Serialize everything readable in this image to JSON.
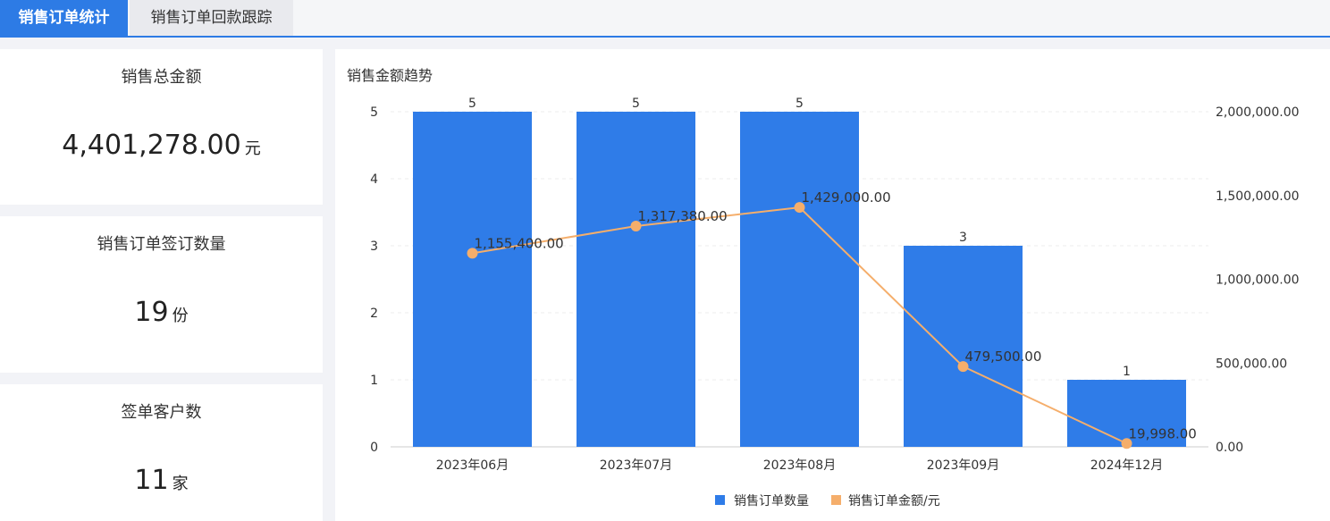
{
  "tabs": [
    {
      "label": "销售订单统计",
      "active": true
    },
    {
      "label": "销售订单回款跟踪",
      "active": false
    }
  ],
  "stats": {
    "total_amount": {
      "label": "销售总金额",
      "value": "4,401,278.00",
      "unit": "元"
    },
    "order_count": {
      "label": "销售订单签订数量",
      "value": "19",
      "unit": "份"
    },
    "customer_count": {
      "label": "签单客户数",
      "value": "11",
      "unit": "家"
    }
  },
  "colors": {
    "accent": "#2d7be5",
    "bar": "#2f7ce8",
    "line": "#f5ae6b"
  },
  "chart_data": {
    "type": "bar",
    "title": "销售金额趋势",
    "categories": [
      "2023年06月",
      "2023年07月",
      "2023年08月",
      "2023年09月",
      "2024年12月"
    ],
    "series": [
      {
        "name": "销售订单数量",
        "type": "bar",
        "axis": "left",
        "values": [
          5,
          5,
          5,
          3,
          1
        ],
        "labels": [
          "5",
          "5",
          "5",
          "3",
          "1"
        ]
      },
      {
        "name": "销售订单金额/元",
        "type": "line",
        "axis": "right",
        "values": [
          1155400,
          1317380,
          1429000,
          479500,
          19998
        ],
        "labels": [
          "1,155,400.00",
          "1,317,380.00",
          "1,429,000.00",
          "479,500.00",
          "19,998.00"
        ]
      }
    ],
    "y_left": {
      "min": 0,
      "max": 5,
      "ticks": [
        "0",
        "1",
        "2",
        "3",
        "4",
        "5"
      ]
    },
    "y_right": {
      "min": 0,
      "max": 2000000,
      "ticks": [
        "0.00",
        "500,000.00",
        "1,000,000.00",
        "1,500,000.00",
        "2,000,000.00"
      ]
    },
    "grid": true,
    "legend": "bottom"
  }
}
